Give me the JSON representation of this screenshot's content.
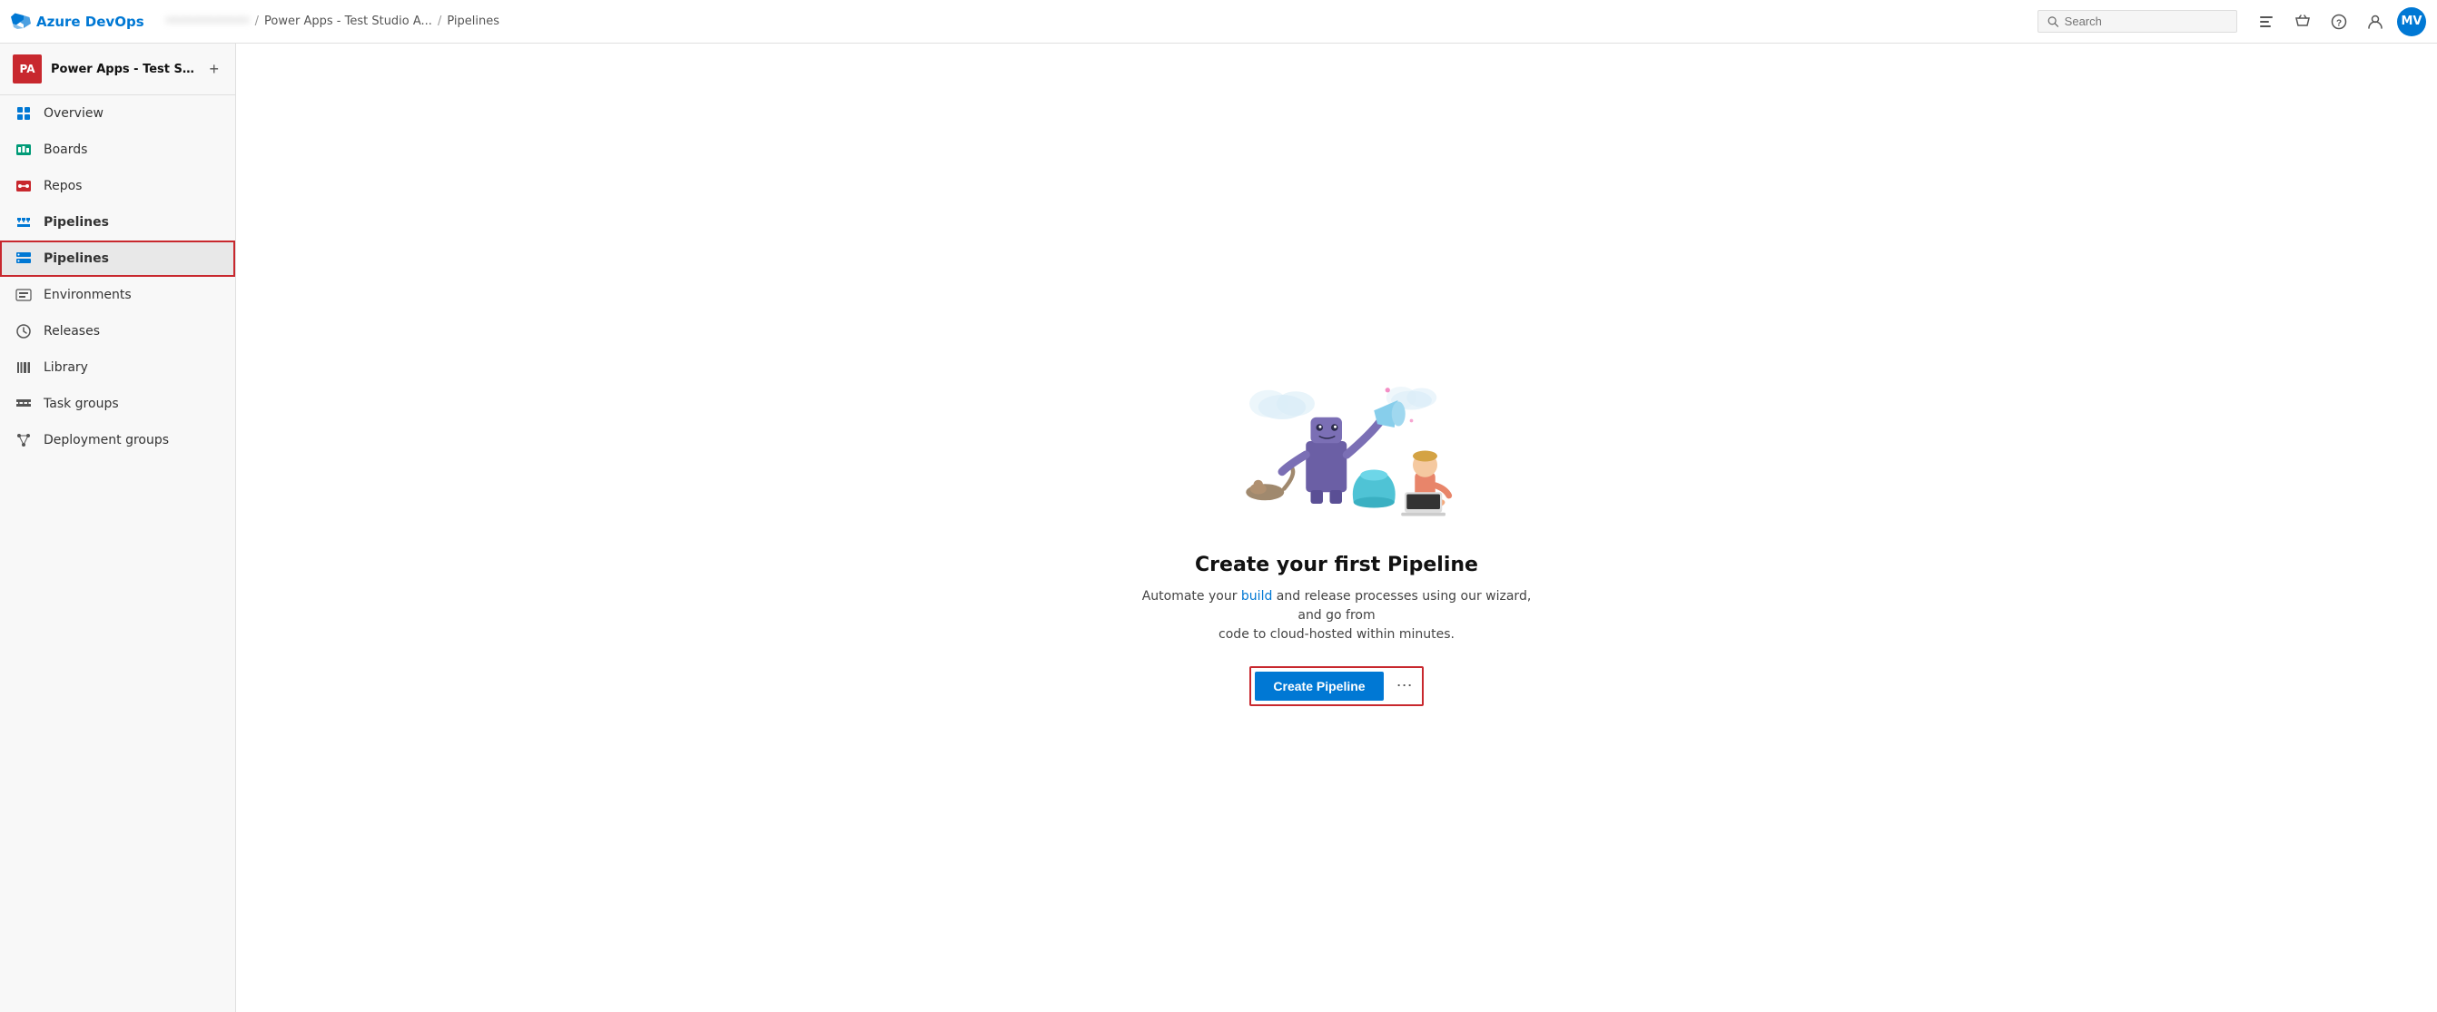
{
  "topbar": {
    "logo_text": "Azure DevOps",
    "breadcrumb": [
      {
        "label": "••••••••••••",
        "blurred": true
      },
      {
        "label": "Power Apps - Test Studio A..."
      },
      {
        "label": "Pipelines"
      }
    ],
    "search_placeholder": "Search",
    "avatar_initials": "MV"
  },
  "sidebar": {
    "project_initials": "PA",
    "project_name": "Power Apps - Test Stud...",
    "add_button_label": "+",
    "nav_items": [
      {
        "id": "overview",
        "label": "Overview",
        "icon": "overview"
      },
      {
        "id": "boards",
        "label": "Boards",
        "icon": "boards"
      },
      {
        "id": "repos",
        "label": "Repos",
        "icon": "repos"
      },
      {
        "id": "pipelines-section",
        "label": "Pipelines",
        "icon": "pipelines-section",
        "section": true
      },
      {
        "id": "pipelines",
        "label": "Pipelines",
        "icon": "pipelines",
        "active": true,
        "outlined": true
      },
      {
        "id": "environments",
        "label": "Environments",
        "icon": "environments"
      },
      {
        "id": "releases",
        "label": "Releases",
        "icon": "releases"
      },
      {
        "id": "library",
        "label": "Library",
        "icon": "library"
      },
      {
        "id": "task-groups",
        "label": "Task groups",
        "icon": "task-groups"
      },
      {
        "id": "deployment-groups",
        "label": "Deployment groups",
        "icon": "deployment-groups"
      }
    ]
  },
  "main": {
    "title": "Create your first Pipeline",
    "description_part1": "Automate your build and ",
    "description_link1": "build",
    "description_part2": " and release processes using our wizard, and go from\ncode to cloud-hosted within minutes.",
    "description": "Automate your build and release processes using our wizard, and go from code to cloud-hosted within minutes.",
    "create_button_label": "Create Pipeline",
    "more_button_label": "⋯"
  }
}
